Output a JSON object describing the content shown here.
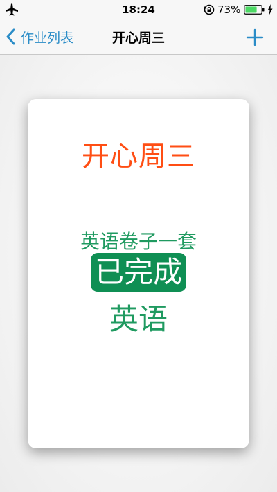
{
  "status_bar": {
    "time": "18:24",
    "battery_percent": "73%",
    "battery_level": 0.73
  },
  "nav": {
    "back_label": "作业列表",
    "title": "开心周三"
  },
  "card": {
    "title": "开心周三",
    "task_description": "英语卷子一套",
    "status": "已完成",
    "subject": "英语"
  },
  "colors": {
    "accent": "#2a8cc7",
    "title": "#ff4e14",
    "green_text": "#1f9a60",
    "badge_bg": "#0f8f54",
    "battery_fill": "#4cd964"
  },
  "icons": {
    "airplane": "airplane-icon",
    "rotation_lock": "rotation-lock-icon",
    "battery": "battery-icon",
    "charging": "charging-icon",
    "back": "chevron-left-icon",
    "add": "plus-icon"
  }
}
